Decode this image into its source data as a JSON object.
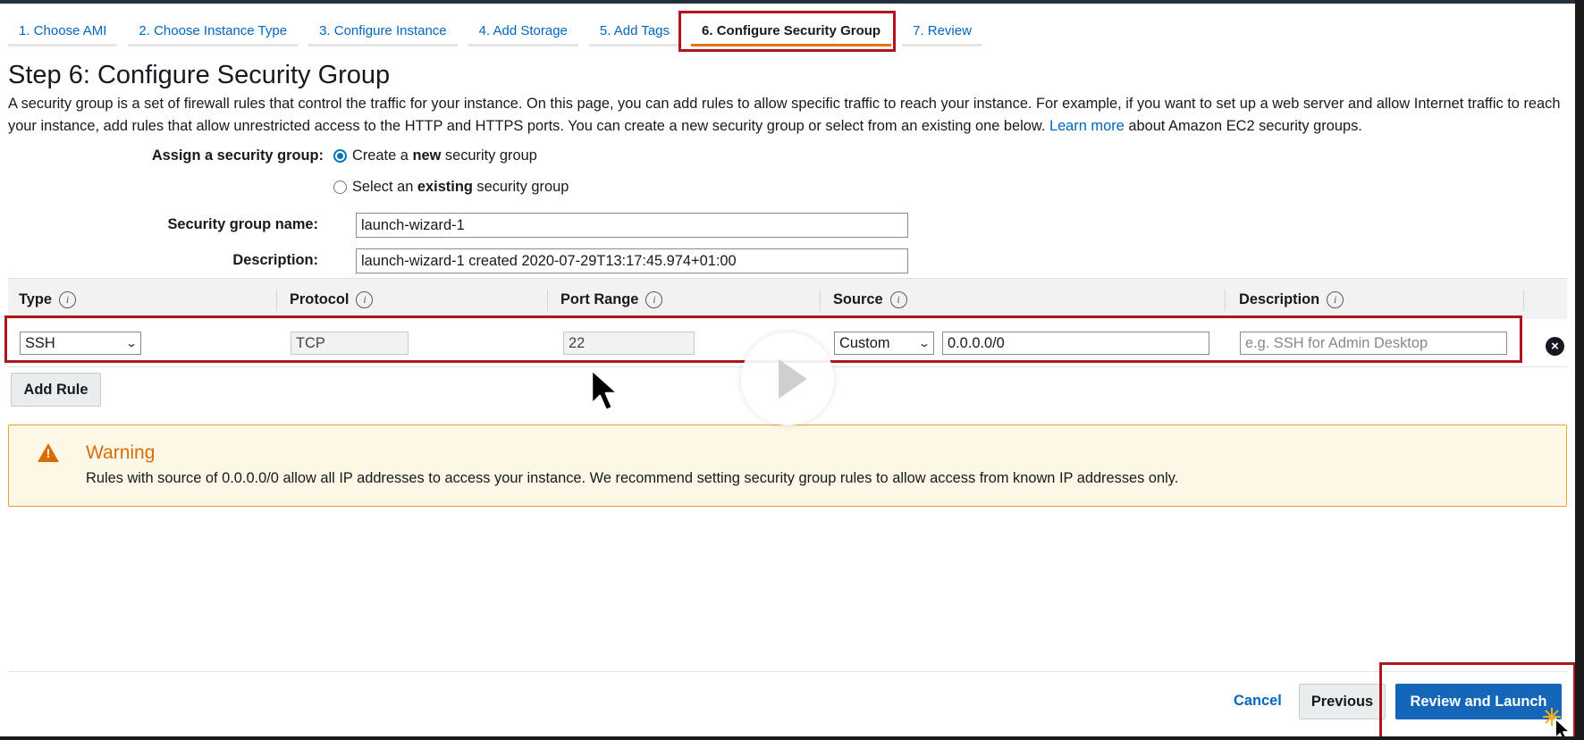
{
  "tabs": [
    {
      "label": "1. Choose AMI"
    },
    {
      "label": "2. Choose Instance Type"
    },
    {
      "label": "3. Configure Instance"
    },
    {
      "label": "4. Add Storage"
    },
    {
      "label": "5. Add Tags"
    },
    {
      "label": "6. Configure Security Group",
      "active": true
    },
    {
      "label": "7. Review"
    }
  ],
  "page": {
    "title": "Step 6: Configure Security Group",
    "intro": "A security group is a set of firewall rules that control the traffic for your instance. On this page, you can add rules to allow specific traffic to reach your instance. For example, if you want to set up a web server and allow Internet traffic to reach your instance, add rules that allow unrestricted access to the HTTP and HTTPS ports. You can create a new security group or select from an existing one below.",
    "learn_more": "Learn more",
    "intro_tail": "about Amazon EC2 security groups."
  },
  "assign": {
    "label": "Assign a security group:",
    "option_new_pre": "Create a",
    "option_new_bold": "new",
    "option_new_post": "security group",
    "option_existing_pre": "Select an",
    "option_existing_bold": "existing",
    "option_existing_post": "security group",
    "selected": "new"
  },
  "form": {
    "name_label": "Security group name:",
    "name_value": "launch-wizard-1",
    "desc_label": "Description:",
    "desc_value": "launch-wizard-1 created 2020-07-29T13:17:45.974+01:00"
  },
  "rules_table": {
    "columns": [
      "Type",
      "Protocol",
      "Port Range",
      "Source",
      "Description"
    ],
    "info_glyph": "i",
    "rows": [
      {
        "type": "SSH",
        "protocol": "TCP",
        "port_range": "22",
        "source_mode": "Custom",
        "source_cidr": "0.0.0.0/0",
        "description_placeholder": "e.g. SSH for Admin Desktop"
      }
    ],
    "add_rule_label": "Add Rule"
  },
  "warning": {
    "title": "Warning",
    "text": "Rules with source of 0.0.0.0/0 allow all IP addresses to access your instance. We recommend setting security group rules to allow access from known IP addresses only."
  },
  "footer": {
    "cancel_label": "Cancel",
    "previous_label": "Previous",
    "review_launch_label": "Review and Launch"
  },
  "colors": {
    "link": "#0066c0",
    "primary_button": "#1466b8",
    "warning_accent": "#d96c07",
    "highlight_box": "#b0151c",
    "active_tab_underline": "#ec7211"
  }
}
